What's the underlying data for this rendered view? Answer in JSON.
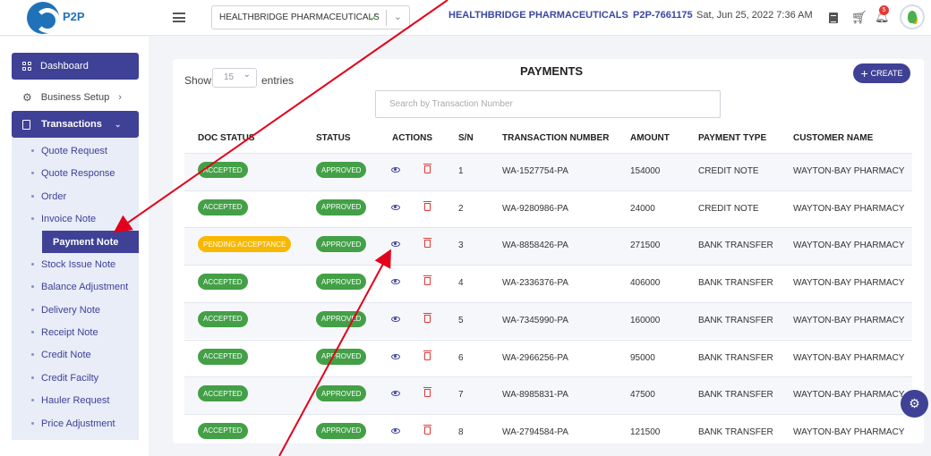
{
  "header": {
    "logo_text": "P2P",
    "company_select": "HEALTHBRIDGE PHARMACEUTICALS",
    "company_name": "HEALTHBRIDGE PHARMACEUTICALS",
    "account_id": "P2P-7661175",
    "datetime": "Sat, Jun 25, 2022 7:36 AM",
    "notification_count": "5"
  },
  "sidebar": {
    "dashboard": "Dashboard",
    "business_setup": "Business Setup",
    "transactions": "Transactions",
    "items": [
      {
        "label": "Quote Request"
      },
      {
        "label": "Quote Response"
      },
      {
        "label": "Order"
      },
      {
        "label": "Invoice Note"
      },
      {
        "label": "Payment Note"
      },
      {
        "label": "Stock Issue Note"
      },
      {
        "label": "Balance Adjustment"
      },
      {
        "label": "Delivery Note"
      },
      {
        "label": "Receipt Note"
      },
      {
        "label": "Credit Note"
      },
      {
        "label": "Credit Facilty"
      },
      {
        "label": "Hauler Request"
      },
      {
        "label": "Price Adjustment"
      }
    ],
    "active_item": "Payment Note"
  },
  "main": {
    "show_label": "Show",
    "entries_value": "15",
    "entries_label": "entries",
    "title": "PAYMENTS",
    "create_label": "CREATE",
    "search_placeholder": "Search by Transaction Number",
    "columns": [
      "DOC STATUS",
      "STATUS",
      "ACTIONS",
      "S/N",
      "TRANSACTION NUMBER",
      "AMOUNT",
      "PAYMENT TYPE",
      "CUSTOMER NAME"
    ],
    "rows": [
      {
        "doc_status": "ACCEPTED",
        "status": "APPROVED",
        "sn": "1",
        "txn": "WA-1527754-PA",
        "amount": "154000",
        "type": "CREDIT NOTE",
        "customer": "WAYTON-BAY PHARMACY"
      },
      {
        "doc_status": "ACCEPTED",
        "status": "APPROVED",
        "sn": "2",
        "txn": "WA-9280986-PA",
        "amount": "24000",
        "type": "CREDIT NOTE",
        "customer": "WAYTON-BAY PHARMACY"
      },
      {
        "doc_status": "PENDING ACCEPTANCE",
        "status": "APPROVED",
        "sn": "3",
        "txn": "WA-8858426-PA",
        "amount": "271500",
        "type": "BANK TRANSFER",
        "customer": "WAYTON-BAY PHARMACY"
      },
      {
        "doc_status": "ACCEPTED",
        "status": "APPROVED",
        "sn": "4",
        "txn": "WA-2336376-PA",
        "amount": "406000",
        "type": "BANK TRANSFER",
        "customer": "WAYTON-BAY PHARMACY"
      },
      {
        "doc_status": "ACCEPTED",
        "status": "APPROVED",
        "sn": "5",
        "txn": "WA-7345990-PA",
        "amount": "160000",
        "type": "BANK TRANSFER",
        "customer": "WAYTON-BAY PHARMACY"
      },
      {
        "doc_status": "ACCEPTED",
        "status": "APPROVED",
        "sn": "6",
        "txn": "WA-2966256-PA",
        "amount": "95000",
        "type": "BANK TRANSFER",
        "customer": "WAYTON-BAY PHARMACY"
      },
      {
        "doc_status": "ACCEPTED",
        "status": "APPROVED",
        "sn": "7",
        "txn": "WA-8985831-PA",
        "amount": "47500",
        "type": "BANK TRANSFER",
        "customer": "WAYTON-BAY PHARMACY"
      },
      {
        "doc_status": "ACCEPTED",
        "status": "APPROVED",
        "sn": "8",
        "txn": "WA-2794584-PA",
        "amount": "121500",
        "type": "BANK TRANSFER",
        "customer": "WAYTON-BAY PHARMACY"
      }
    ]
  },
  "colors": {
    "primary": "#3f4196",
    "accepted": "#43a047",
    "pending": "#f9b800",
    "danger": "#e53935",
    "annotation_arrow": "#e3001b"
  }
}
